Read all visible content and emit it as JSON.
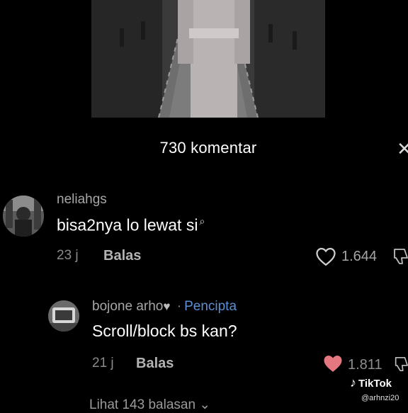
{
  "header": {
    "comment_count_label": "730 komentar",
    "close_icon": "close-icon"
  },
  "comments": [
    {
      "username": "neliahgs",
      "text": "bisa2nya lo lewat si",
      "text_suffix_icon": "search-icon",
      "time": "23 j",
      "reply_label": "Balas",
      "likes": "1.644",
      "liked": false
    },
    {
      "username": "bojone arho",
      "username_suffix_icon": "heart-icon",
      "creator_label": "Pencipta",
      "separator": "·",
      "text": "Scroll/block bs kan?",
      "time": "21 j",
      "reply_label": "Balas",
      "likes": "1.811",
      "liked": true
    }
  ],
  "view_replies_label": "Lihat 143 balasan",
  "view_replies_icon": "chevron-down-icon",
  "watermark": {
    "brand": "TikTok",
    "user": "@arhnzi20"
  },
  "colors": {
    "background": "#000000",
    "liked_heart": "#e4777f",
    "creator": "#5b8fd6"
  }
}
